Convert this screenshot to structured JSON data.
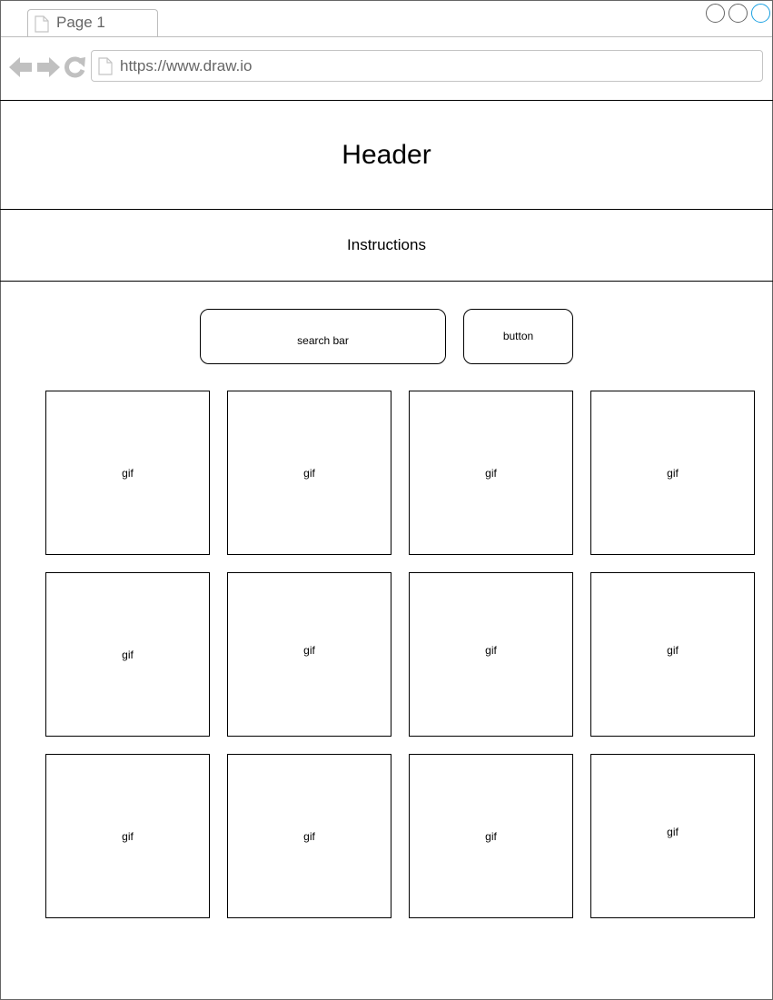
{
  "browser": {
    "tab_label": "Page 1",
    "url": "https://www.draw.io"
  },
  "page": {
    "header": "Header",
    "instructions": "Instructions",
    "search_bar_label": "search bar",
    "button_label": "button",
    "gifs": [
      "gif",
      "gif",
      "gif",
      "gif",
      "gif",
      "gif",
      "gif",
      "gif",
      "gif",
      "gif",
      "gif",
      "gif"
    ]
  },
  "colors": {
    "active_window_control": "#1ba1e2",
    "browser_chrome_gray": "#c0c0c0"
  }
}
